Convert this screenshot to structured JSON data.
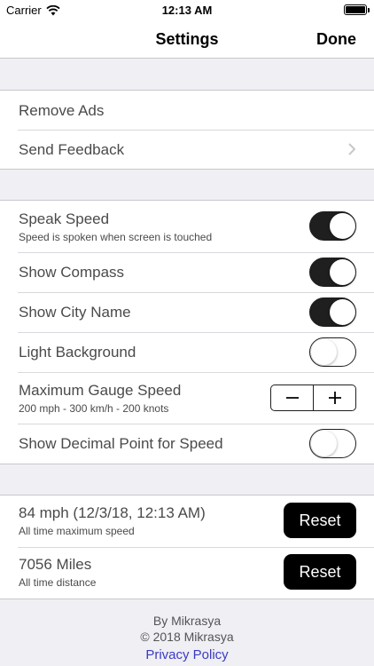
{
  "status_bar": {
    "carrier": "Carrier",
    "time": "12:13 AM",
    "icons": [
      "wifi-icon",
      "battery-icon"
    ]
  },
  "nav": {
    "title": "Settings",
    "done_label": "Done"
  },
  "purchase_group": {
    "remove_ads": "Remove Ads",
    "send_feedback": "Send Feedback"
  },
  "settings_group": {
    "speak_speed": {
      "title": "Speak Speed",
      "subtitle": "Speed is spoken when screen is touched",
      "on": true
    },
    "show_compass": {
      "title": "Show Compass",
      "on": true
    },
    "show_city_name": {
      "title": "Show City Name",
      "on": true
    },
    "light_background": {
      "title": "Light Background",
      "on": false
    },
    "max_gauge_speed": {
      "title": "Maximum Gauge Speed",
      "subtitle": "200 mph - 300 km/h - 200 knots",
      "minus": "−",
      "plus": "+"
    },
    "show_decimal": {
      "title": "Show Decimal Point for Speed",
      "on": false
    }
  },
  "stats_group": {
    "max_speed": {
      "title": "84 mph (12/3/18, 12:13 AM)",
      "subtitle": "All time maximum speed",
      "button": "Reset"
    },
    "distance": {
      "title": "7056 Miles",
      "subtitle": "All time distance",
      "button": "Reset"
    }
  },
  "footer": {
    "by": "By Mikrasya",
    "copyright": "© 2018 Mikrasya",
    "privacy": "Privacy Policy"
  },
  "colors": {
    "switch_on": "#1f1f1f",
    "background": "#efeff4",
    "link": "#3b3bc4"
  }
}
